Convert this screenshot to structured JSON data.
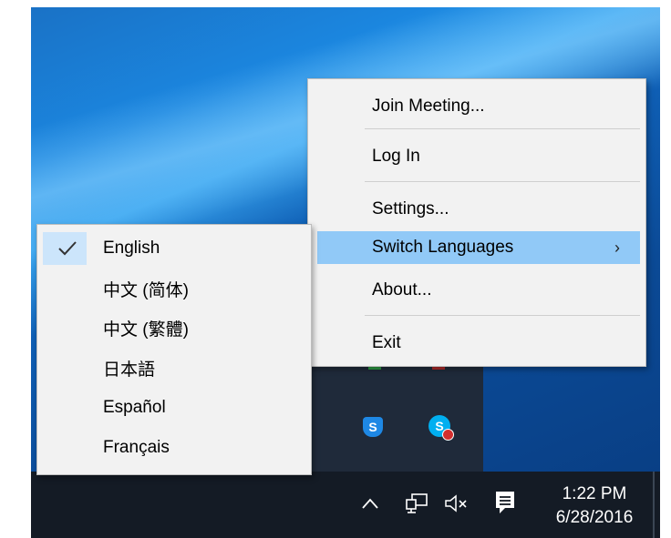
{
  "context_menu": {
    "items": [
      {
        "label": "Join Meeting..."
      },
      {
        "label": "Log In"
      },
      {
        "label": "Settings..."
      },
      {
        "label": "Switch Languages",
        "submenu_arrow": "›",
        "highlighted": true
      },
      {
        "label": "About..."
      },
      {
        "label": "Exit"
      }
    ]
  },
  "language_submenu": {
    "items": [
      {
        "label": "English",
        "checked": true
      },
      {
        "label": "中文 (简体)"
      },
      {
        "label": "中文 (繁體)"
      },
      {
        "label": "日本語"
      },
      {
        "label": "Español"
      },
      {
        "label": "Français"
      }
    ]
  },
  "tray_overflow": {
    "icons": [
      "security-shield-icon",
      "skype-icon"
    ],
    "shield_glyph": "S",
    "skype_glyph": "S"
  },
  "taskbar": {
    "chevron": "^",
    "icons": [
      "show-hidden-icons-chevron-icon",
      "network-icon",
      "volume-muted-icon",
      "action-center-icon"
    ],
    "time": "1:22 PM",
    "date": "6/28/2016"
  },
  "colors": {
    "highlight": "#91c9f7",
    "menu_background": "#f2f2f2",
    "taskbar": "#141b25"
  }
}
